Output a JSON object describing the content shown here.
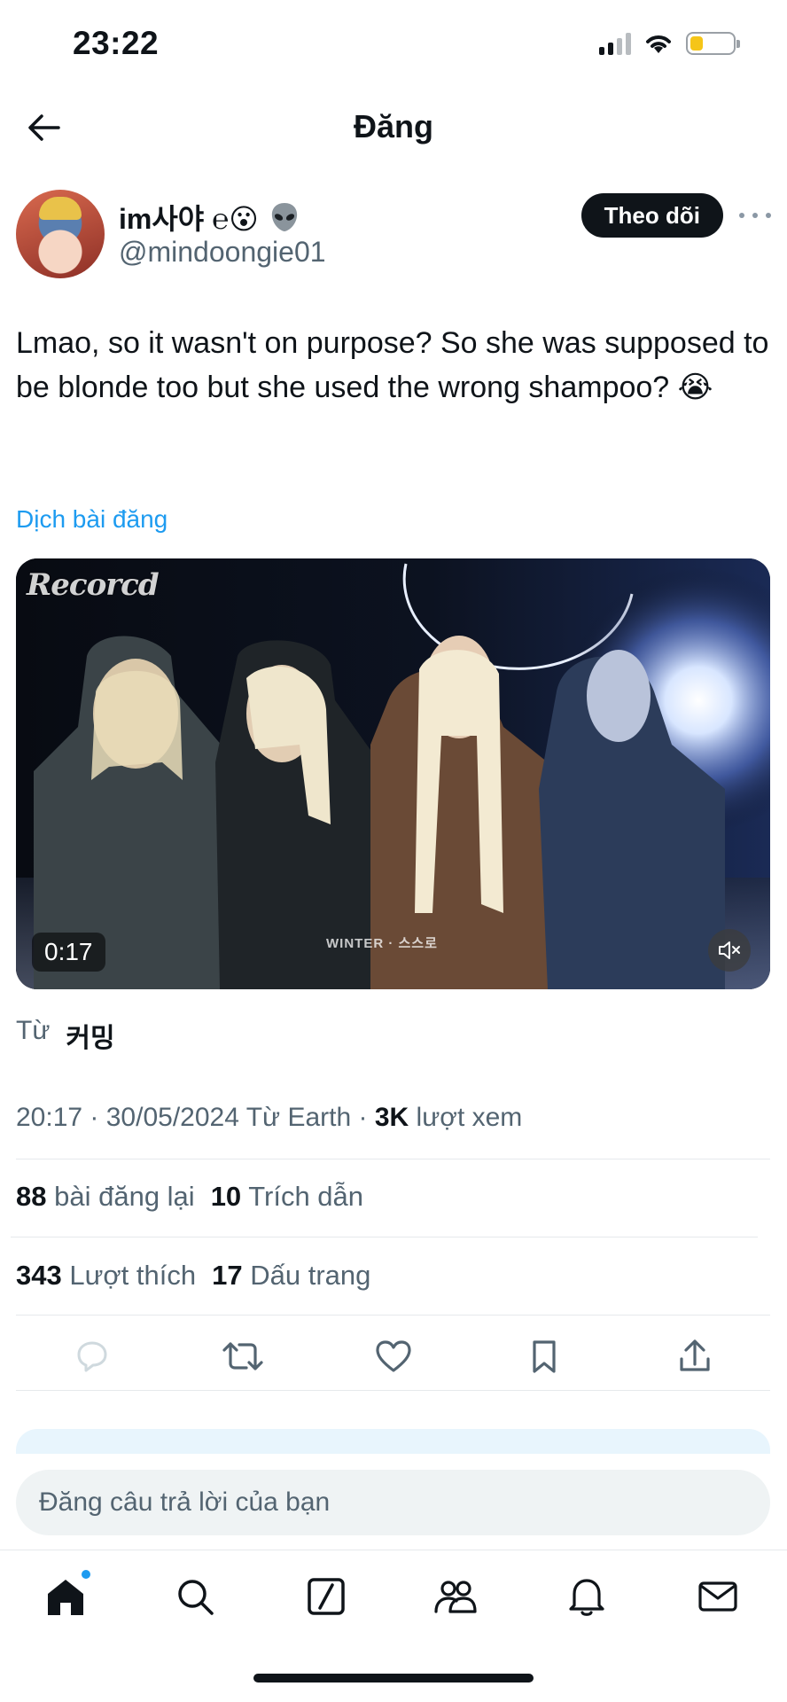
{
  "status_bar": {
    "time": "23:22",
    "battery_level": 0.3,
    "battery_color": "#f5c518"
  },
  "header": {
    "title": "Đăng",
    "back_icon": "arrow-left-icon"
  },
  "author": {
    "display_name": "im사야 ℮😮",
    "emoji_icon": "alien-icon",
    "handle": "@mindoongie01",
    "follow_label": "Theo dõi",
    "more_icon": "more-horizontal-icon"
  },
  "tweet": {
    "text": "Lmao, so it wasn't on purpose? So she was supposed to be blonde too but she used the wrong shampoo? 😭",
    "translate_label": "Dịch bài đăng"
  },
  "video": {
    "logo_text": "Recorcd",
    "watermark": "WINTER · 스스로",
    "duration": "0:17",
    "mute_icon": "speaker-muted-icon"
  },
  "source": {
    "label": "Từ",
    "name": "커밍"
  },
  "meta": {
    "time": "20:17",
    "date": "30/05/2024",
    "from": "Từ Earth",
    "views_count": "3K",
    "views_label": "lượt xem"
  },
  "stats": {
    "reposts_count": "88",
    "reposts_label": "bài đăng lại",
    "quotes_count": "10",
    "quotes_label": "Trích dẫn",
    "likes_count": "343",
    "likes_label": "Lượt thích",
    "bookmarks_count": "17",
    "bookmarks_label": "Dấu trang"
  },
  "actions": [
    "reply-icon",
    "retweet-icon",
    "heart-icon",
    "bookmark-icon",
    "share-icon"
  ],
  "reply": {
    "placeholder": "Đăng câu trả lời của bạn"
  },
  "tabbar": {
    "items": [
      "home-icon",
      "search-icon",
      "grok-icon",
      "communities-icon",
      "bell-icon",
      "mail-icon"
    ],
    "accent": "#1d9bf0"
  }
}
